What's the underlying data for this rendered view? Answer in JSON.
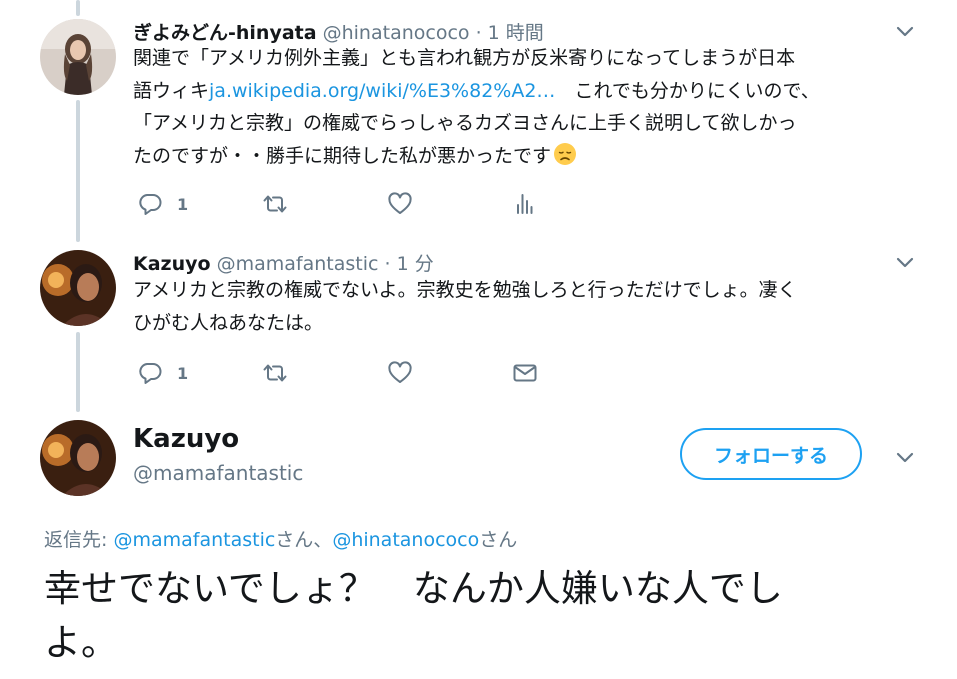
{
  "tweets": [
    {
      "name": "ぎよみどん-hinyata",
      "handle": "@hinatanococo",
      "time": "· 1 時間",
      "text_lines": [
        "関連で「アメリカ例外主義」とも言われ観方が反米寄りになってしまうが日本",
        "語ウィキ",
        "　これでも分かりにくいので、",
        "「アメリカと宗教」の権威でらっしゃるカズヨさんに上手く説明して欲しかっ",
        "たのですが・・勝手に期待した私が悪かったです"
      ],
      "link_text": "ja.wikipedia.org/wiki/%E3%82%A2…",
      "emoji": "disappointed-face",
      "reply_count": "1"
    },
    {
      "name": "Kazuyo",
      "handle": "@mamafantastic",
      "time": "· 1 分",
      "text_lines": [
        "アメリカと宗教の権威でないよ。宗教史を勉強しろと行っただけでしょ。凄く",
        "ひがむ人ねあなたは。"
      ],
      "reply_count": "1"
    }
  ],
  "main_tweet": {
    "name": "Kazuyo",
    "handle": "@mamafantastic",
    "follow_label": "フォローする",
    "reply_prefix": "返信先: ",
    "reply_user1": "@mamafantastic",
    "reply_suffix1": "さん、",
    "reply_user2": "@hinatanococo",
    "reply_suffix2": "さん",
    "text_line1": "幸せでないでしょ？　なんか人嫌いな人でし",
    "text_line2": "よ。"
  },
  "colors": {
    "accent": "#1da1f2",
    "link": "#1b95e0",
    "secondary_text": "#657786",
    "thread_line": "#ccd6dd"
  },
  "icons": [
    "reply-icon",
    "retweet-icon",
    "like-icon",
    "analytics-icon",
    "direct-message-icon",
    "chevron-down-icon"
  ]
}
